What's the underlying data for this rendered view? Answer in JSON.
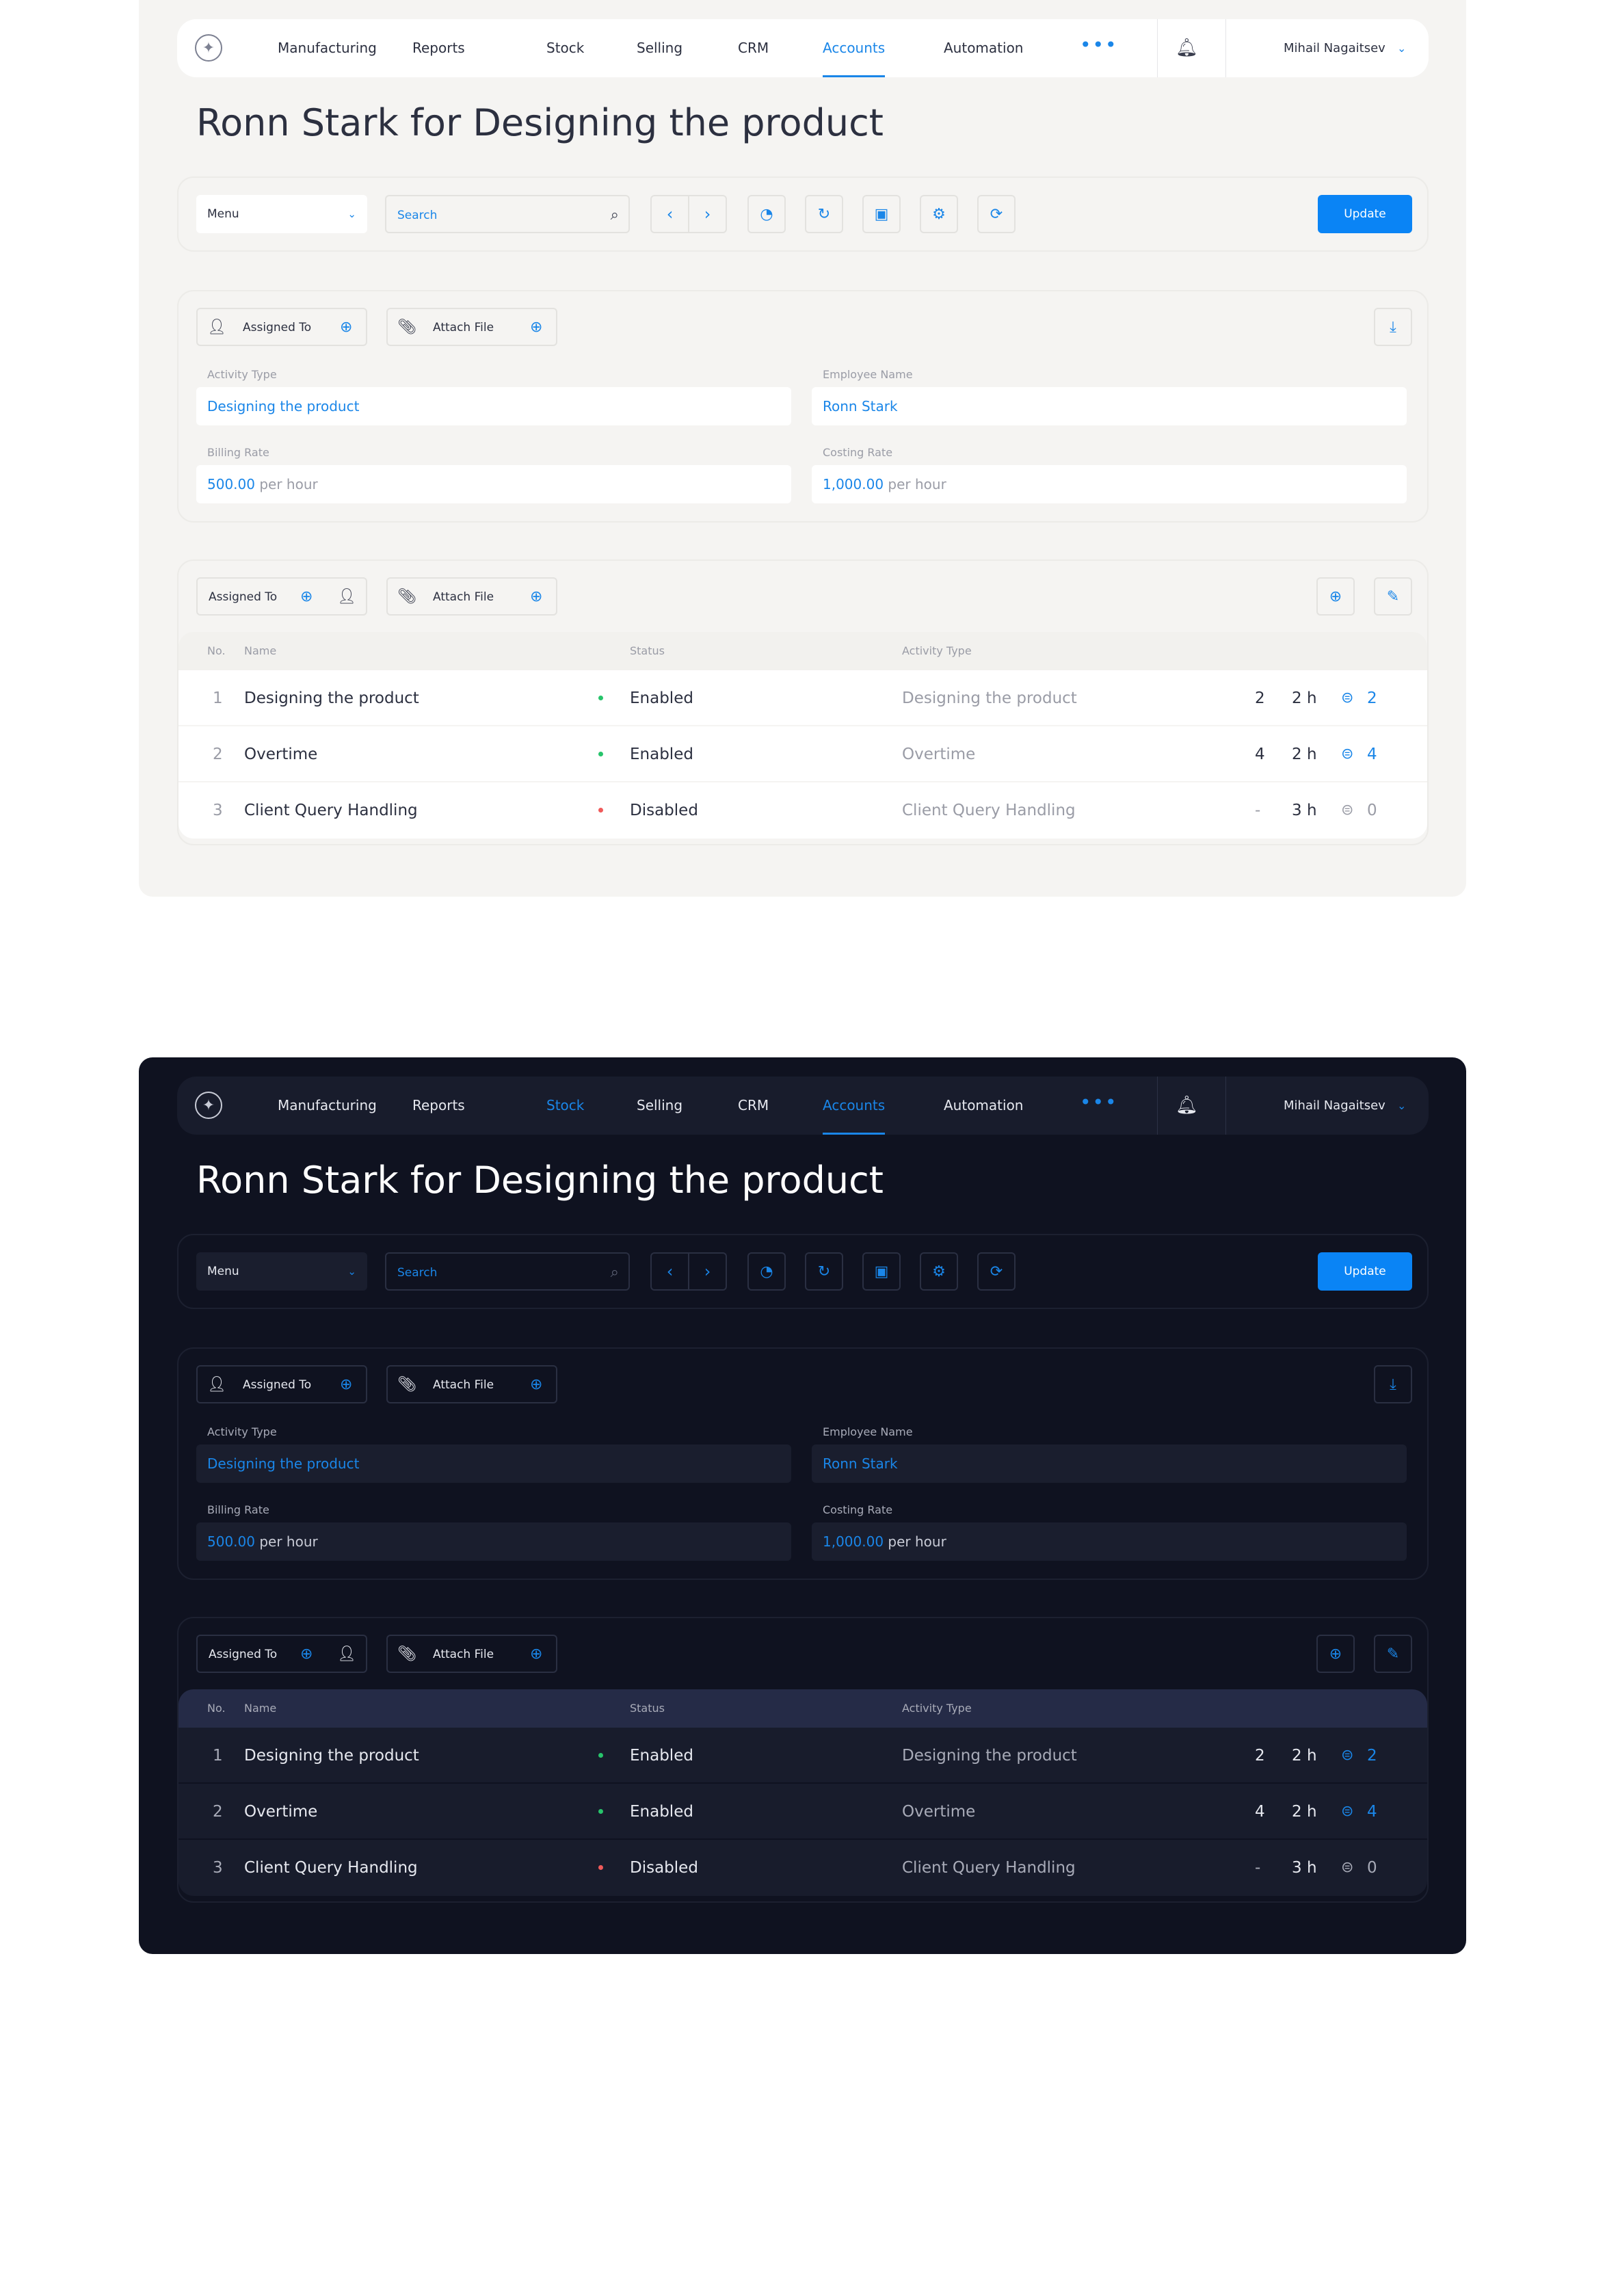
{
  "nav": {
    "items": [
      "Manufacturing",
      "Reports",
      "Stock",
      "Selling",
      "CRM",
      "Accounts",
      "Automation"
    ],
    "more_label": "•••",
    "user": "Mihail Nagaitsev"
  },
  "page": {
    "title": "Ronn Stark for Designing the product"
  },
  "toolbar": {
    "menu_label": "Menu",
    "search_placeholder": "Search",
    "update_label": "Update"
  },
  "details": {
    "assigned_to_label": "Assigned To",
    "attach_file_label": "Attach File",
    "activity_type_label": "Activity Type",
    "activity_type_value": "Designing the product",
    "employee_name_label": "Employee Name",
    "employee_name_value": "Ronn Stark",
    "billing_rate_label": "Billing Rate",
    "billing_rate_value": "500.00",
    "billing_rate_unit": "per hour",
    "costing_rate_label": "Costing Rate",
    "costing_rate_value": "1,000.00",
    "costing_rate_unit": "per hour"
  },
  "table": {
    "assigned_to_label": "Assigned To",
    "attach_file_label": "Attach File",
    "headers": {
      "no": "No.",
      "name": "Name",
      "status": "Status",
      "activity_type": "Activity Type"
    },
    "rows": [
      {
        "no": "1",
        "name": "Designing the product",
        "status": "Enabled",
        "activity_type": "Designing the product",
        "qty": "2",
        "hours": "2 h",
        "docs": "2"
      },
      {
        "no": "2",
        "name": "Overtime",
        "status": "Enabled",
        "activity_type": "Overtime",
        "qty": "4",
        "hours": "2 h",
        "docs": "4"
      },
      {
        "no": "3",
        "name": "Client Query Handling",
        "status": "Disabled",
        "activity_type": "Client Query Handling",
        "qty": "-",
        "hours": "3 h",
        "docs": "0"
      }
    ]
  },
  "colors": {
    "accent": "#1a86e8",
    "enabled": "#27c46b",
    "disabled": "#f05a5a",
    "dark_bg": "#0f1220",
    "light_bg": "#f5f4f2"
  },
  "icons": {
    "logo": "sparkle-icon",
    "bell": "bell-icon",
    "search": "search-icon",
    "prev": "chevron-left-icon",
    "next": "chevron-right-icon",
    "chart": "pie-chart-icon",
    "refresh": "refresh-icon",
    "save": "save-icon",
    "settings": "settings-icon",
    "download": "download-icon",
    "add": "plus-circle-icon",
    "edit": "edit-icon",
    "user_add": "user-add-icon",
    "attach": "paperclip-icon",
    "doc": "document-icon"
  }
}
